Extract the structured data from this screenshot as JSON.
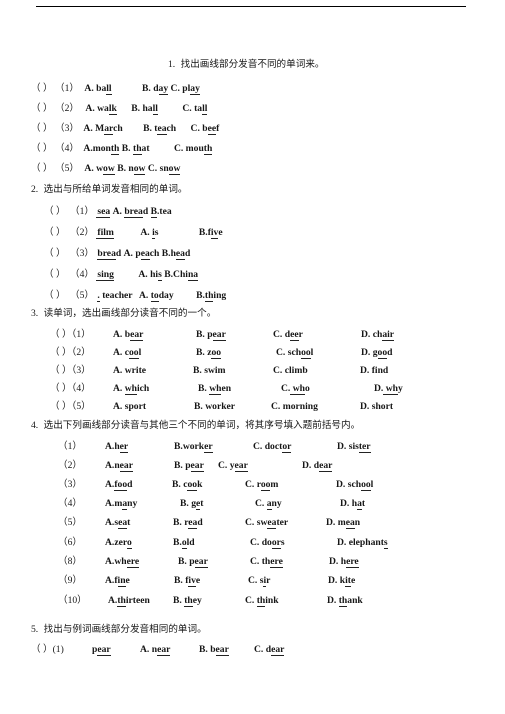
{
  "document": {
    "type": "worksheet",
    "language": "zh-CN/en",
    "has_top_rule": true
  },
  "sections": [
    {
      "number": "1.",
      "heading": "找出画线部分发音不同的单词来。",
      "bracket_style": "wide",
      "items": [
        {
          "bracket": "（      ）",
          "label": "（1）",
          "options": [
            {
              "letter": "A.",
              "pre": " ba",
              "seg": "ll",
              "post": ""
            },
            {
              "letter": "B.",
              "pre": " d",
              "seg": "ay",
              "post": ""
            },
            {
              "letter": "C.",
              "pre": " pl",
              "seg": "ay",
              "post": ""
            }
          ]
        },
        {
          "bracket": "（      ）",
          "label": "（2）",
          "options": [
            {
              "letter": "A.",
              "pre": " wa",
              "seg": "lk",
              "post": ""
            },
            {
              "letter": "B.",
              "pre": " ha",
              "seg": "ll",
              "post": ""
            },
            {
              "letter": "C.",
              "pre": " ta",
              "seg": "ll",
              "post": ""
            }
          ]
        },
        {
          "bracket": "（      ）",
          "label": "（3）",
          "options": [
            {
              "letter": "A.",
              "pre": " M",
              "seg": "ar",
              "post": "ch"
            },
            {
              "letter": "B.",
              "pre": " t",
              "seg": "ea",
              "post": "ch"
            },
            {
              "letter": "C.",
              "pre": " b",
              "seg": "ee",
              "post": "f"
            }
          ]
        },
        {
          "bracket": "（      ）",
          "label": "（4）",
          "options": [
            {
              "letter": "A.",
              "pre": "mon",
              "seg": "th",
              "post": ""
            },
            {
              "letter": "B.",
              "pre": " ",
              "seg": "th",
              "post": "at"
            },
            {
              "letter": "C.",
              "pre": " mou",
              "seg": "th",
              "post": ""
            }
          ]
        },
        {
          "bracket": "（      ）",
          "label": "（5）",
          "options": [
            {
              "letter": "A.",
              "pre": " w",
              "seg": "ow",
              "post": ""
            },
            {
              "letter": "B.",
              "pre": " n",
              "seg": "ow",
              "post": ""
            },
            {
              "letter": "C.",
              "pre": " sn",
              "seg": "ow",
              "post": ""
            }
          ]
        }
      ]
    },
    {
      "number": "2.",
      "heading": "选出与所给单词发音相同的单词。",
      "bracket_style": "wide",
      "items": [
        {
          "bracket": "（      ）",
          "label": "（1）",
          "stem": "sea",
          "options": [
            {
              "letter": "A.",
              "pre": " ",
              "seg": "brea",
              "post": "d"
            },
            {
              "letter": "B.",
              "pre": "",
              "seg": "t",
              "post": "ea"
            }
          ]
        },
        {
          "bracket": "（      ）",
          "label": "（2）",
          "stem": "film",
          "options": [
            {
              "letter": "A.",
              "pre": " ",
              "seg": "i",
              "post": "s"
            },
            {
              "letter": "B.",
              "pre": "f",
              "seg": "iv",
              "post": "e"
            }
          ]
        },
        {
          "bracket": "（      ）",
          "label": "（3）",
          "stem": "bread",
          "options": [
            {
              "letter": "A.",
              "pre": " p",
              "seg": "ea",
              "post": "ch"
            },
            {
              "letter": "B.",
              "pre": "h",
              "seg": "ea",
              "post": "d"
            }
          ]
        },
        {
          "bracket": "（      ）",
          "label": "（4）",
          "stem": "sing",
          "options": [
            {
              "letter": "A.",
              "pre": " hi",
              "seg": "s",
              "post": ""
            },
            {
              "letter": "B.",
              "pre": "Chi",
              "seg": "na",
              "post": ""
            }
          ]
        },
        {
          "bracket": "（      ）",
          "label": "（5）",
          "stem": "teacher",
          "options": [
            {
              "letter": "A.",
              "pre": " ",
              "seg": "to",
              "post": "day"
            },
            {
              "letter": "B.",
              "pre": "",
              "seg": "th",
              "post": "ing"
            }
          ]
        }
      ]
    },
    {
      "number": "3.",
      "heading": "读单词，选出画线部分读音不同的一个。",
      "bracket_style": "narrow",
      "items": [
        {
          "bracket": "（ ）",
          "label": "（1）",
          "options": [
            {
              "letter": "A.",
              "pre": " b",
              "seg": "ear",
              "post": ""
            },
            {
              "letter": "B.",
              "pre": " p",
              "seg": "ear",
              "post": ""
            },
            {
              "letter": "C.",
              "pre": " d",
              "seg": "ee",
              "post": "r"
            },
            {
              "letter": "D.",
              "pre": " ch",
              "seg": "air",
              "post": ""
            }
          ]
        },
        {
          "bracket": "（ ）",
          "label": "（2）",
          "options": [
            {
              "letter": "A.",
              "pre": " c",
              "seg": "oo",
              "post": "l"
            },
            {
              "letter": "B.",
              "pre": " z",
              "seg": "oo",
              "post": ""
            },
            {
              "letter": "C.",
              "pre": " sch",
              "seg": "oo",
              "post": "l"
            },
            {
              "letter": "D.",
              "pre": " g",
              "seg": "oo",
              "post": "d"
            }
          ]
        },
        {
          "bracket": "（ ）",
          "label": "（3）",
          "options": [
            {
              "letter": "A.",
              "pre": " wr",
              "seg": "i",
              "post": "te"
            },
            {
              "letter": "B.",
              "pre": " sw",
              "seg": "i",
              "post": "m"
            },
            {
              "letter": "C.",
              "pre": " cl",
              "seg": "i",
              "post": "mb"
            },
            {
              "letter": "D.",
              "pre": " f",
              "seg": "i",
              "post": "nd"
            }
          ]
        },
        {
          "bracket": "（ ）",
          "label": "（4）",
          "options": [
            {
              "letter": "A.",
              "pre": " ",
              "seg": "wh",
              "post": "ich"
            },
            {
              "letter": "B.",
              "pre": " ",
              "seg": "wh",
              "post": "en"
            },
            {
              "letter": "C.",
              "pre": " ",
              "seg": "wh",
              "post": "o"
            },
            {
              "letter": "D.",
              "pre": " ",
              "seg": "wh",
              "post": "y"
            }
          ]
        },
        {
          "bracket": "（ ）",
          "label": "（5）",
          "options": [
            {
              "letter": "A.",
              "pre": " sp",
              "seg": "or",
              "post": "t"
            },
            {
              "letter": "B.",
              "pre": " w",
              "seg": "or",
              "post": "ker"
            },
            {
              "letter": "C.",
              "pre": " m",
              "seg": "or",
              "post": "ning"
            },
            {
              "letter": "D.",
              "pre": " sh",
              "seg": "or",
              "post": "t"
            }
          ]
        }
      ]
    },
    {
      "number": "4.",
      "heading": "选出下列画线部分读音与其他三个不同的单词，将其序号填入题前括号内。",
      "bracket_style": "none",
      "items": [
        {
          "label": "（1）",
          "options": [
            {
              "letter": "A.",
              "pre": "h",
              "seg": "er",
              "post": ""
            },
            {
              "letter": "B.",
              "pre": "work",
              "seg": "er",
              "post": ""
            },
            {
              "letter": "C.",
              "pre": " doct",
              "seg": "or",
              "post": ""
            },
            {
              "letter": "D.",
              "pre": " sis",
              "seg": "ter",
              "post": ""
            }
          ]
        },
        {
          "label": "（2）",
          "options": [
            {
              "letter": "A.",
              "pre": "n",
              "seg": "ear",
              "post": ""
            },
            {
              "letter": "B.",
              "pre": " p",
              "seg": "ear",
              "post": ""
            },
            {
              "letter": "C.",
              "pre": " y",
              "seg": "ear",
              "post": ""
            },
            {
              "letter": "D.",
              "pre": " d",
              "seg": "ear",
              "post": ""
            }
          ]
        },
        {
          "label": "（3）",
          "options": [
            {
              "letter": "A.",
              "pre": "f",
              "seg": "oo",
              "post": "d"
            },
            {
              "letter": "B.",
              "pre": " c",
              "seg": "oo",
              "post": "k"
            },
            {
              "letter": "C.",
              "pre": " r",
              "seg": "oo",
              "post": "m"
            },
            {
              "letter": "D.",
              "pre": " sch",
              "seg": "oo",
              "post": "l"
            }
          ]
        },
        {
          "label": "（4）",
          "options": [
            {
              "letter": "A.",
              "pre": "m",
              "seg": "a",
              "post": "ny"
            },
            {
              "letter": "B.",
              "pre": " g",
              "seg": "e",
              "post": "t"
            },
            {
              "letter": "C.",
              "pre": " ",
              "seg": "a",
              "post": "ny"
            },
            {
              "letter": "D.",
              "pre": " h",
              "seg": "a",
              "post": "t"
            }
          ]
        },
        {
          "label": "（5）",
          "options": [
            {
              "letter": "A.",
              "pre": "s",
              "seg": "ea",
              "post": "t"
            },
            {
              "letter": "B.",
              "pre": " r",
              "seg": "ea",
              "post": "d"
            },
            {
              "letter": "C.",
              "pre": " sw",
              "seg": "ea",
              "post": "ter"
            },
            {
              "letter": "D.",
              "pre": " m",
              "seg": "ea",
              "post": "n"
            }
          ]
        },
        {
          "label": "（6）",
          "options": [
            {
              "letter": "A.",
              "pre": "zer",
              "seg": "o",
              "post": ""
            },
            {
              "letter": "B.",
              "pre": "",
              "seg": "o",
              "post": "ld"
            },
            {
              "letter": "C.",
              "pre": " do",
              "seg": "or",
              "post": "s"
            },
            {
              "letter": "D.",
              "pre": " elephant",
              "seg": "s",
              "post": ""
            }
          ]
        },
        {
          "label": "（8）",
          "options": [
            {
              "letter": "A.",
              "pre": "wh",
              "seg": "ere",
              "post": ""
            },
            {
              "letter": "B.",
              "pre": " p",
              "seg": "ear",
              "post": ""
            },
            {
              "letter": "C.",
              "pre": " th",
              "seg": "ere",
              "post": ""
            },
            {
              "letter": "D.",
              "pre": " h",
              "seg": "ere",
              "post": ""
            }
          ]
        },
        {
          "label": "（9）",
          "options": [
            {
              "letter": "A.",
              "pre": "f",
              "seg": "in",
              "post": "e"
            },
            {
              "letter": "B.",
              "pre": " f",
              "seg": "iv",
              "post": "e"
            },
            {
              "letter": "C.",
              "pre": " s",
              "seg": "i",
              "post": "r"
            },
            {
              "letter": "D.",
              "pre": " k",
              "seg": "it",
              "post": "e"
            }
          ]
        },
        {
          "label": "（10）",
          "options": [
            {
              "letter": "A.",
              "pre": "",
              "seg": "th",
              "post": "irteen"
            },
            {
              "letter": "B.",
              "pre": " ",
              "seg": "th",
              "post": "ey"
            },
            {
              "letter": "C.",
              "pre": " ",
              "seg": "th",
              "post": "ink"
            },
            {
              "letter": "D.",
              "pre": " ",
              "seg": "th",
              "post": "ank"
            }
          ]
        }
      ]
    },
    {
      "number": "5.",
      "heading": "找出与例词画线部分发音相同的单词。",
      "bracket_style": "wide",
      "items": [
        {
          "bracket": "（     ）",
          "label": "(1)",
          "stem_pre": "p",
          "stem_seg": "ear",
          "options": [
            {
              "letter": "A.",
              "pre": " n",
              "seg": "ear",
              "post": ""
            },
            {
              "letter": "B.",
              "pre": " b",
              "seg": "ear",
              "post": ""
            },
            {
              "letter": "C.",
              "pre": " d",
              "seg": "ear",
              "post": ""
            }
          ]
        }
      ]
    }
  ]
}
